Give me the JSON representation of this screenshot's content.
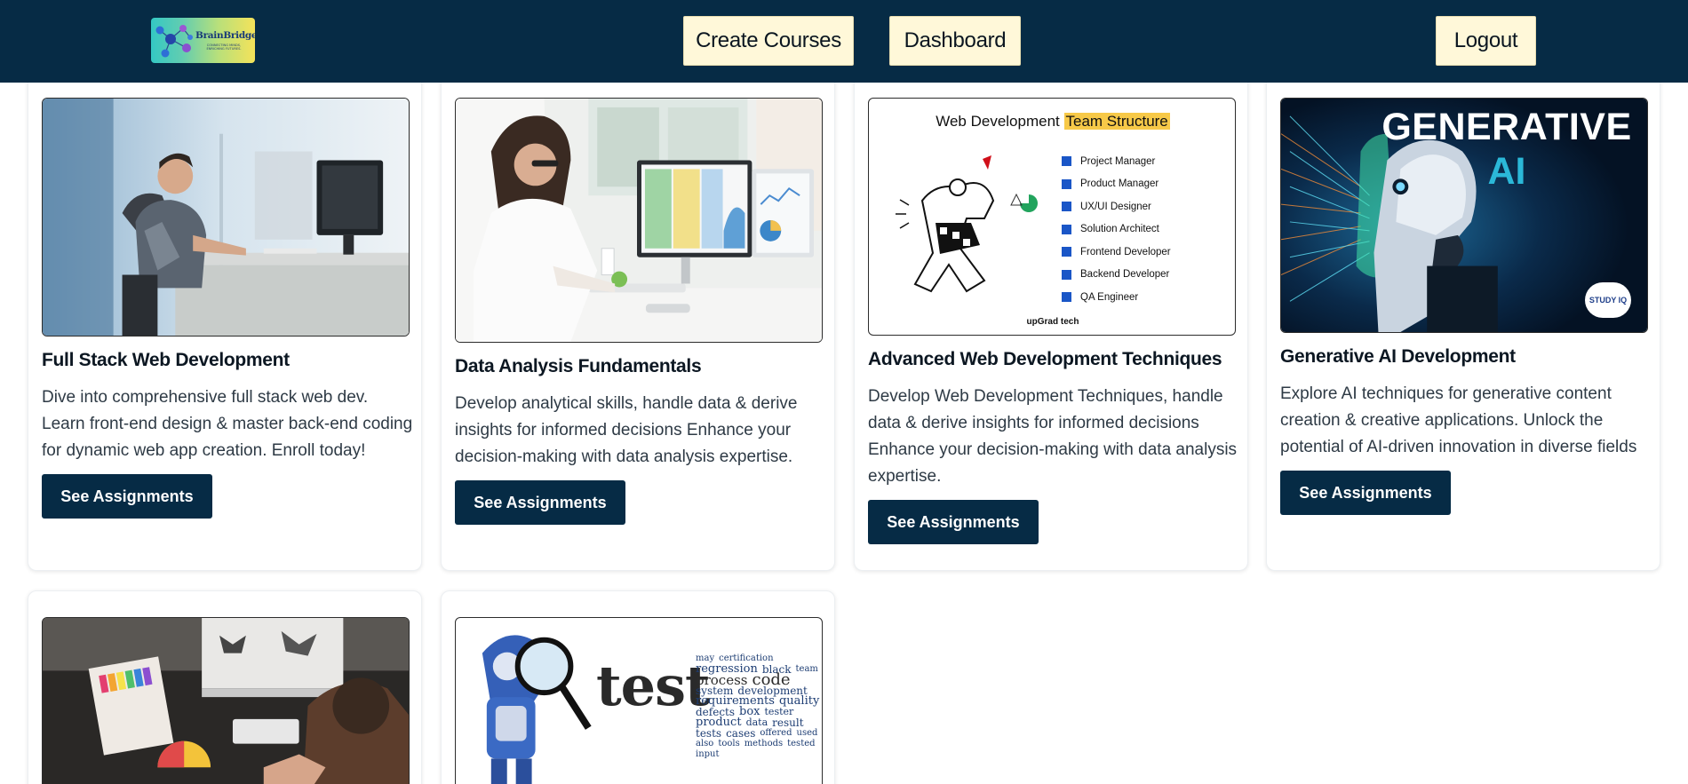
{
  "header": {
    "logo": {
      "name": "BrainBridge",
      "tagline_line1": "CONNECTING MINDS,",
      "tagline_line2": "ENRICHING FUTURES."
    },
    "create_courses_label": "Create Courses",
    "dashboard_label": "Dashboard",
    "logout_label": "Logout"
  },
  "courses": [
    {
      "title": "Full Stack Web Development",
      "description": "Dive into comprehensive full stack web dev. Learn front-end design & master back-end coding for dynamic web app creation. Enroll today!",
      "button_label": "See Assignments"
    },
    {
      "title": "Data Analysis Fundamentals",
      "description": "Develop analytical skills, handle data & derive insights for informed decisions Enhance your decision-making with data analysis expertise.",
      "button_label": "See Assignments"
    },
    {
      "title": "Advanced Web Development Techniques",
      "description": "Develop Web Development Techniques, handle data & derive insights for informed decisions Enhance your decision-making with data analysis expertise.",
      "button_label": "See Assignments",
      "image_text": {
        "heading_prefix": "Web Development",
        "heading_highlight": "Team Structure",
        "roles": [
          "Project Manager",
          "Product Manager",
          "UX/UI Designer",
          "Solution Architect",
          "Frontend Developer",
          "Backend Developer",
          "QA Engineer"
        ],
        "brand": "upGrad",
        "brand_suffix": "tech"
      }
    },
    {
      "title": "Generative AI Development",
      "description": "Explore AI techniques for generative content creation & creative applications. Unlock the potential of AI-driven innovation in diverse fields",
      "button_label": "See Assignments",
      "image_text": {
        "line1": "GENERATIVE",
        "line2": "AI",
        "badge": "STUDY IQ"
      }
    },
    {
      "image": "designer-desk-photo"
    },
    {
      "image_text": {
        "big_word": "test",
        "cloud": [
          "process",
          "code",
          "system",
          "requirements",
          "development",
          "defects",
          "quality",
          "box",
          "tester",
          "product",
          "data",
          "result",
          "cases",
          "tests",
          "offered",
          "regression",
          "black",
          "team",
          "used",
          "also",
          "may",
          "certification",
          "tools",
          "methods",
          "tested",
          "input"
        ]
      }
    }
  ],
  "colors": {
    "navy": "#062b45",
    "nav_button_bg": "#fff8d9",
    "card_border": "#eceff2",
    "highlight": "#f7c948",
    "ai_teal": "#2bb8d8"
  }
}
